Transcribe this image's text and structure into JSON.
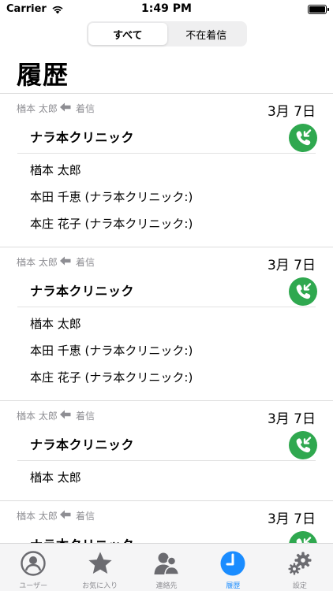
{
  "status_bar": {
    "carrier": "Carrier",
    "time": "1:49 PM"
  },
  "segments": [
    {
      "label": "すべて",
      "active": true
    },
    {
      "label": "不在着信",
      "active": false
    }
  ],
  "page_title": "履歴",
  "entries": [
    {
      "caller": "楢本 太郎",
      "call_type": "着信",
      "date": "3月 7日",
      "group": "ナラ本クリニック",
      "members": [
        "楢本 太郎",
        "本田 千恵 (ナラ本クリニック:)",
        "本庄 花子 (ナラ本クリニック:)"
      ]
    },
    {
      "caller": "楢本 太郎",
      "call_type": "着信",
      "date": "3月 7日",
      "group": "ナラ本クリニック",
      "members": [
        "楢本 太郎",
        "本田 千恵 (ナラ本クリニック:)",
        "本庄 花子 (ナラ本クリニック:)"
      ]
    },
    {
      "caller": "楢本 太郎",
      "call_type": "着信",
      "date": "3月 7日",
      "group": "ナラ本クリニック",
      "members": [
        "楢本 太郎"
      ]
    },
    {
      "caller": "楢本 太郎",
      "call_type": "着信",
      "date": "3月 7日",
      "group": "ナラ本クリニック",
      "members": []
    }
  ],
  "tabs": [
    {
      "label": "ユーザー",
      "icon": "user-circle-icon",
      "active": false
    },
    {
      "label": "お気に入り",
      "icon": "star-icon",
      "active": false
    },
    {
      "label": "連絡先",
      "icon": "contacts-icon",
      "active": false
    },
    {
      "label": "履歴",
      "icon": "clock-icon",
      "active": true
    },
    {
      "label": "設定",
      "icon": "gear-icon",
      "active": false
    }
  ],
  "colors": {
    "accent": "#1a8cff",
    "call_badge": "#2fa84f",
    "secondary_text": "#8e8e93",
    "tab_inactive_icon": "#6b6b70"
  }
}
